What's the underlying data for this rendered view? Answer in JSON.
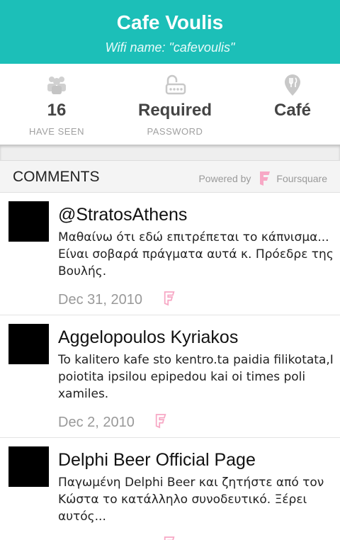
{
  "header": {
    "title": "Cafe Voulis",
    "wifi": "Wifi name: \"cafevoulis\""
  },
  "stats": [
    {
      "icon": "people-icon",
      "value": "16",
      "label": "HAVE SEEN"
    },
    {
      "icon": "lock-icon",
      "value": "Required",
      "label": "PASSWORD"
    },
    {
      "icon": "location-pin-icon",
      "value": "Café",
      "label": ""
    }
  ],
  "comments": {
    "heading": "COMMENTS",
    "powered_by": "Powered by",
    "provider": "Foursquare",
    "accent_color": "#f7a8c5",
    "items": [
      {
        "author": "@StratosAthens",
        "text": "Μαθαίνω ότι εδώ επιτρέπεται το κάπνισμα... Είναι σοβαρά πράγματα αυτά κ. Πρόεδρε της Βουλής.",
        "date": "Dec 31, 2010"
      },
      {
        "author": "Aggelopoulos Kyriakos",
        "text": "To kalitero kafe sto kentro.ta paidia filikotata,I poiotita ipsilou epipedou kai oi times poli xamiles.",
        "date": "Dec 2, 2010"
      },
      {
        "author": "Delphi Beer Official Page",
        "text": "Παγωμένη Delphi Beer και ζητήστε από τον Κώστα το κατάλληλο συνοδευτικό. Ξέρει αυτός...",
        "date": ""
      }
    ]
  },
  "colors": {
    "header_bg": "#1cbfb8",
    "foursquare_pink": "#f7a8c5"
  }
}
